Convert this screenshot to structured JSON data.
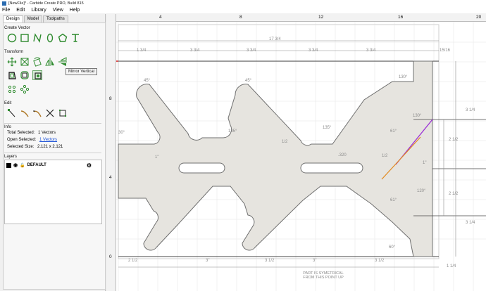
{
  "window": {
    "title": "[NewFile]* - Carbide Create PRO, Build 815"
  },
  "menu": [
    "File",
    "Edit",
    "Library",
    "View",
    "Help"
  ],
  "panel": {
    "tabs": [
      "Design",
      "Model",
      "Toolpaths"
    ],
    "create_vector_title": "Create Vector",
    "transform_title": "Transform",
    "edit_title": "Edit",
    "info_title": "Info",
    "layers_title": "Layers",
    "tooltip": "Mirror Vertical"
  },
  "info": {
    "total_label": "Total Selected:",
    "total_value": "1 Vectors",
    "open_label": "Open Selected:",
    "open_value": "1 Vectors",
    "size_label": "Selected Size:",
    "size_value": "2.121 x 2.121"
  },
  "layers": [
    {
      "name": "DEFAULT",
      "color": "#000000"
    }
  ],
  "ruler": {
    "top_labels": [
      "4",
      "8",
      "12",
      "16",
      "20"
    ],
    "left_labels": [
      "8",
      "4",
      "0"
    ]
  },
  "dimensions": {
    "overall_width": "17 3/4",
    "top_segments": [
      "1 3/4",
      "3 3/4",
      "3 3/4",
      "3 3/4",
      "3 3/4",
      "15/16"
    ],
    "bottom_segments": [
      "2 1/2",
      "3\"",
      "3 1/2",
      "3\"",
      "3 1/2",
      "1 1/4"
    ],
    "right_segments": [
      "3 1/4",
      "2 1/2",
      "2 1/2",
      "3 1/4"
    ],
    "angles": [
      "45°",
      "45°",
      "135°",
      "135°",
      "135°",
      "30°",
      "61°",
      "61°",
      "120°",
      "130°",
      "60°"
    ],
    "slot_width": ".320",
    "left_offset": "1\"",
    "misc": [
      "1/2",
      "1\""
    ]
  },
  "note": {
    "line1": "PART IS SYMETRICAL",
    "line2": "FROM THIS POINT UP"
  },
  "colors": {
    "part_fill": "#e8e6e1",
    "part_stroke": "#777777",
    "selected_vector": "#9b2fd6",
    "offset_vector": "#e28a1f",
    "axis_red": "#d42020"
  }
}
